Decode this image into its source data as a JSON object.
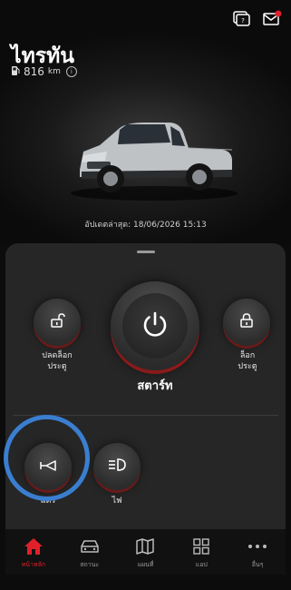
{
  "header": {
    "vehicle_name": "ไทรทัน",
    "range_value": "816",
    "range_unit": "km",
    "updated_text": "อัปเดตล่าสุด: 18/06/2026 15:13",
    "icons": [
      "chat-badge-icon",
      "mail-notification-icon"
    ]
  },
  "controls": {
    "unlock_label_1": "ปลดล็อก",
    "unlock_label_2": "ประตู",
    "start_label": "สตาร์ท",
    "lock_label_1": "ล็อก",
    "lock_label_2": "ประตู",
    "horn_label": "แตร",
    "lights_label": "ไฟ"
  },
  "nav": {
    "items": [
      {
        "label": "หน้าหลัก",
        "icon": "home-icon",
        "active": true
      },
      {
        "label": "สถานะ",
        "icon": "car-status-icon",
        "active": false
      },
      {
        "label": "แผนที่",
        "icon": "map-icon",
        "active": false
      },
      {
        "label": "แอป",
        "icon": "apps-grid-icon",
        "active": false
      },
      {
        "label": "อื่นๆ",
        "icon": "more-icon",
        "active": false
      }
    ]
  },
  "colors": {
    "accent_red": "#e0202a",
    "highlight_blue": "#3a7ed0",
    "panel_bg": "#262626"
  }
}
